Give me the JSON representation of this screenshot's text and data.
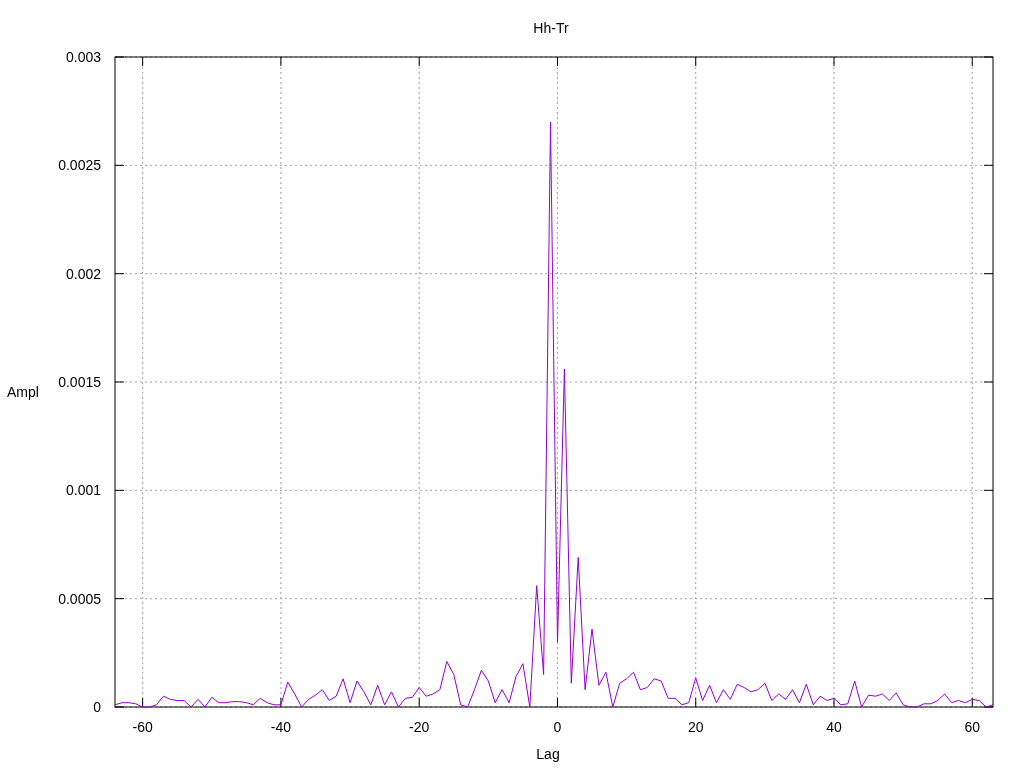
{
  "chart_data": {
    "type": "line",
    "grid": true,
    "title": "Hh-Tr",
    "xlabel": "Lag",
    "ylabel": "Ampl",
    "xlim": [
      -64,
      63
    ],
    "ylim": [
      0,
      0.003
    ],
    "xticks": [
      -60,
      -40,
      -20,
      0,
      20,
      40,
      60
    ],
    "yticks": [
      0,
      0.0005,
      0.001,
      0.0015,
      0.002,
      0.0025,
      0.003
    ],
    "x": [
      -64,
      -63,
      -62,
      -61,
      -60,
      -59,
      -58,
      -57,
      -56,
      -55,
      -54,
      -53,
      -52,
      -51,
      -50,
      -49,
      -48,
      -47,
      -46,
      -45,
      -44,
      -43,
      -42,
      -41,
      -40,
      -39,
      -38,
      -37,
      -36,
      -35,
      -34,
      -33,
      -32,
      -31,
      -30,
      -29,
      -28,
      -27,
      -26,
      -25,
      -24,
      -23,
      -22,
      -21,
      -20,
      -19,
      -18,
      -17,
      -16,
      -15,
      -14,
      -13,
      -12,
      -11,
      -10,
      -9,
      -8,
      -7,
      -6,
      -5,
      -4,
      -3,
      -2,
      -1,
      0,
      1,
      2,
      3,
      4,
      5,
      6,
      7,
      8,
      9,
      10,
      11,
      12,
      13,
      14,
      15,
      16,
      17,
      18,
      19,
      20,
      21,
      22,
      23,
      24,
      25,
      26,
      27,
      28,
      29,
      30,
      31,
      32,
      33,
      34,
      35,
      36,
      37,
      38,
      39,
      40,
      41,
      42,
      43,
      44,
      45,
      46,
      47,
      48,
      49,
      50,
      51,
      52,
      53,
      54,
      55,
      56,
      57,
      58,
      59,
      60,
      61,
      62,
      63
    ],
    "series": [
      {
        "color": "#9400d3",
        "values": [
          1e-05,
          2e-05,
          2e-05,
          1.5e-05,
          0,
          0,
          1e-05,
          5e-05,
          3.5e-05,
          3e-05,
          3e-05,
          0,
          3.5e-05,
          0,
          4.5e-05,
          2e-05,
          2e-05,
          2.5e-05,
          2.5e-05,
          2e-05,
          1e-05,
          4e-05,
          2e-05,
          1e-05,
          1e-05,
          0.000115,
          6e-05,
          0,
          3.5e-05,
          5.5e-05,
          8e-05,
          3e-05,
          5e-05,
          0.00013,
          2e-05,
          0.00012,
          7e-05,
          1e-05,
          0.0001,
          1e-05,
          7e-05,
          0,
          4e-05,
          4.5e-05,
          9e-05,
          5e-05,
          6e-05,
          8e-05,
          0.00021,
          0.00015,
          1e-05,
          0,
          8e-05,
          0.00017,
          0.00012,
          2e-05,
          8e-05,
          2e-05,
          0.00014,
          0.0002,
          0,
          0.00056,
          0.00015,
          0.0027,
          0.0003,
          0.00156,
          0.00011,
          0.00069,
          8e-05,
          0.00036,
          0.0001,
          0.00016,
          0,
          0.00011,
          0.00013,
          0.00016,
          8e-05,
          9e-05,
          0.00013,
          0.00012,
          4e-05,
          4e-05,
          1e-05,
          2e-05,
          0.000135,
          3e-05,
          0.0001,
          2e-05,
          8e-05,
          3.5e-05,
          0.000105,
          9e-05,
          7e-05,
          8e-05,
          0.00011,
          3e-05,
          6e-05,
          3.5e-05,
          8e-05,
          2e-05,
          0.000105,
          1e-05,
          5e-05,
          3e-05,
          4e-05,
          1e-05,
          1.5e-05,
          0.00012,
          0,
          5.5e-05,
          5e-05,
          6e-05,
          3e-05,
          6.5e-05,
          1e-05,
          0,
          0,
          1.5e-05,
          1.5e-05,
          3e-05,
          6e-05,
          2e-05,
          3e-05,
          2e-05,
          3.5e-05,
          3e-05,
          0,
          1e-05
        ]
      }
    ]
  }
}
